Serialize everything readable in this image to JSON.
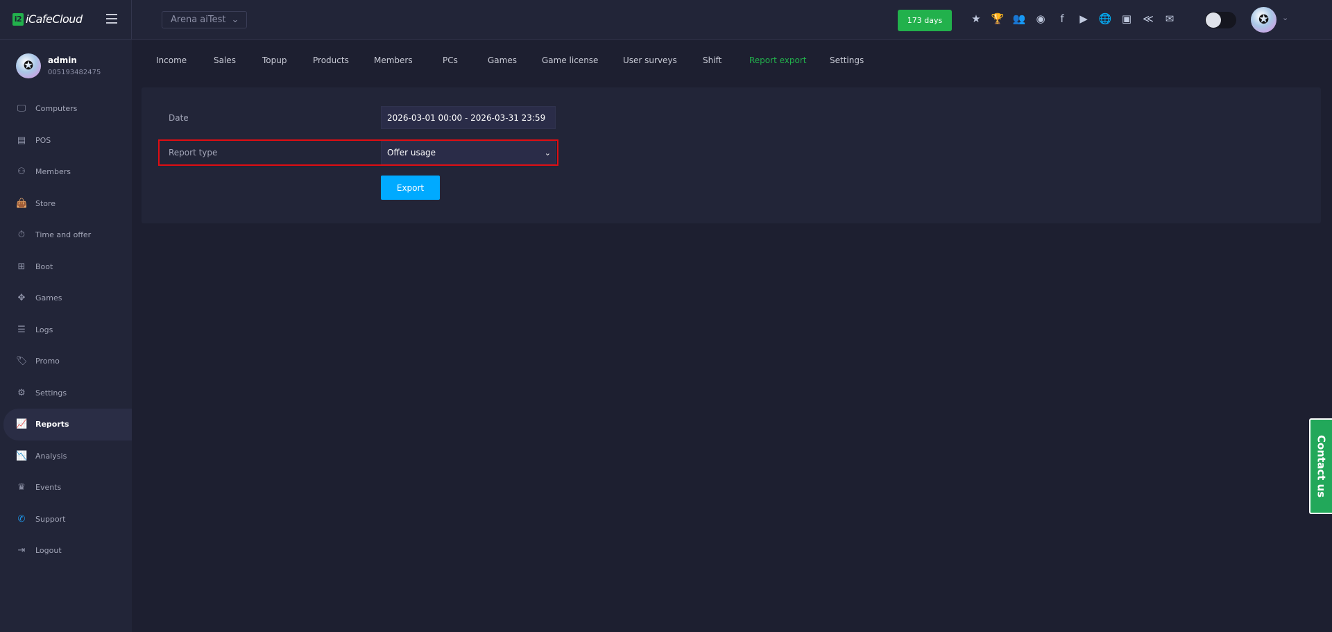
{
  "topbar": {
    "logo_text": "iCafeCloud",
    "logo_mark": "i2",
    "branch": "Arena aiTest",
    "days_badge": "173 days",
    "icons": [
      {
        "name": "ranking-icon",
        "glyph": "★"
      },
      {
        "name": "trophy-icon",
        "glyph": "🏆"
      },
      {
        "name": "community-icon",
        "glyph": "👥"
      },
      {
        "name": "rss-icon",
        "glyph": "◉"
      },
      {
        "name": "facebook-icon",
        "glyph": "f"
      },
      {
        "name": "youtube-icon",
        "glyph": "▶"
      },
      {
        "name": "globe-icon",
        "glyph": "🌐"
      },
      {
        "name": "icafe-icon",
        "glyph": "▣"
      },
      {
        "name": "partner-icon",
        "glyph": "≪"
      },
      {
        "name": "mail-icon",
        "glyph": "✉"
      }
    ]
  },
  "user": {
    "name": "admin",
    "id": "005193482475"
  },
  "sidebar": {
    "items": [
      {
        "label": "Computers",
        "icon": "🖵"
      },
      {
        "label": "POS",
        "icon": "▤"
      },
      {
        "label": "Members",
        "icon": "⚇"
      },
      {
        "label": "Store",
        "icon": "👜"
      },
      {
        "label": "Time and offer",
        "icon": "⏱"
      },
      {
        "label": "Boot",
        "icon": "⊞"
      },
      {
        "label": "Games",
        "icon": "✥"
      },
      {
        "label": "Logs",
        "icon": "☰"
      },
      {
        "label": "Promo",
        "icon": "🏷"
      },
      {
        "label": "Settings",
        "icon": "⚙"
      },
      {
        "label": "Reports",
        "icon": "📈"
      },
      {
        "label": "Analysis",
        "icon": "📉"
      },
      {
        "label": "Events",
        "icon": "♛"
      },
      {
        "label": "Support",
        "icon": "✆"
      },
      {
        "label": "Logout",
        "icon": "⇥"
      }
    ]
  },
  "tabs": [
    "Income",
    "Sales",
    "Topup",
    "Products",
    "Members",
    "PCs",
    "Games",
    "Game license",
    "User surveys",
    "Shift",
    "Report export",
    "Settings"
  ],
  "form": {
    "date_label": "Date",
    "date_value": "2026-03-01 00:00 - 2026-03-31 23:59",
    "report_type_label": "Report type",
    "report_type_value": "Offer usage",
    "export_label": "Export"
  },
  "contact": "Contact us"
}
